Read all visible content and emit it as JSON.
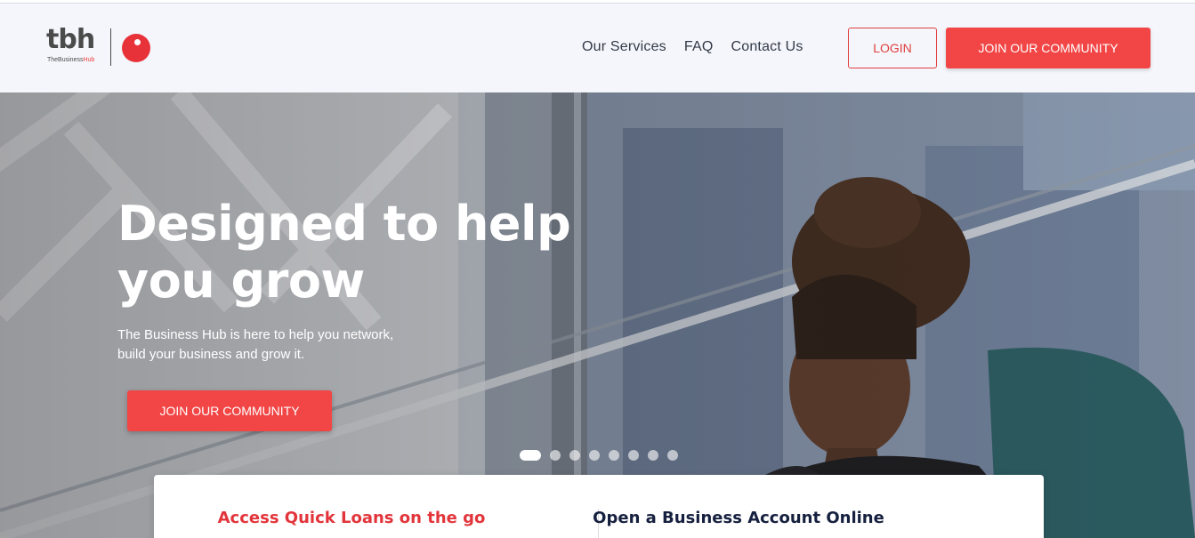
{
  "brand": {
    "logo_text": "tbh",
    "logo_sub_prefix": "TheBusiness",
    "logo_sub_accent": "Hub",
    "accent_color": "#f24646"
  },
  "nav": {
    "items": [
      "Our Services",
      "FAQ",
      "Contact Us"
    ],
    "login_label": "LOGIN",
    "join_label": "JOIN OUR COMMUNITY"
  },
  "hero": {
    "title_line1": "Designed to help",
    "title_line2": "you grow",
    "subtitle_line1": "The Business Hub is here to help you network,",
    "subtitle_line2": "build your business and grow it.",
    "cta_label": "JOIN OUR COMMUNITY",
    "carousel": {
      "slide_count": 8,
      "active_index": 0
    }
  },
  "features": {
    "left_title": "Access Quick Loans on the go",
    "right_title": "Open a Business Account Online"
  }
}
